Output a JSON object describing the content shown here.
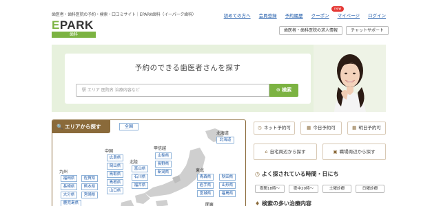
{
  "header": {
    "tagline": "歯医者・歯科医院の予約・検索・口コミサイト｜EPARK歯科（イーパーク歯科）",
    "logo_text": "EPARK",
    "logo_sub": "歯科",
    "nav": [
      "初めての方へ",
      "会員登録",
      "予約履歴",
      "クーポン",
      "マイページ",
      "ログイン"
    ],
    "new_badge": "new",
    "btn_jobs": "歯医者・歯科医院の求人情報",
    "btn_chat": "チャットサポート"
  },
  "hero": {
    "title": "予約のできる歯医者さんを探す",
    "placeholder": "駅 エリア 医院名 治療内容など",
    "search_label": "検索"
  },
  "area": {
    "title": "エリアから探す",
    "all_label": "全国",
    "regions": {
      "hokkaido": "北海道",
      "chugoku": "中国",
      "hokuriku": "北陸",
      "koshinetsu": "甲信越",
      "tohoku": "東北",
      "kyushu": "九州",
      "kanto": "関東"
    },
    "prefs": {
      "hokkaido": [
        "北海道"
      ],
      "chugoku": [
        "広島県",
        "岡山県",
        "鳥取県",
        "島根県",
        "山口県"
      ],
      "hokuriku": [
        "富山県",
        "石川県",
        "福井県"
      ],
      "koshinetsu": [
        "山梨県",
        "長野県",
        "新潟県"
      ],
      "tohoku": [
        "青森県",
        "秋田県",
        "岩手県",
        "山形県",
        "宮城県",
        "福島県"
      ],
      "kyushu": [
        "福岡県",
        "佐賀県",
        "長崎県",
        "熊本県",
        "大分県",
        "宮崎県",
        "鹿児島県"
      ]
    }
  },
  "quick": {
    "net": "ネット予約可",
    "today": "今日予約可",
    "tomorrow": "明日予約可",
    "home": "自宅周辺から探す",
    "work": "職場周辺から探す"
  },
  "times": {
    "title": "よく探されている時間・日にち",
    "pills": [
      "夜間18時〜",
      "夜中20時〜",
      "土曜診療",
      "日曜診療"
    ]
  },
  "treatments": {
    "title": "検索の多い治療内容"
  }
}
